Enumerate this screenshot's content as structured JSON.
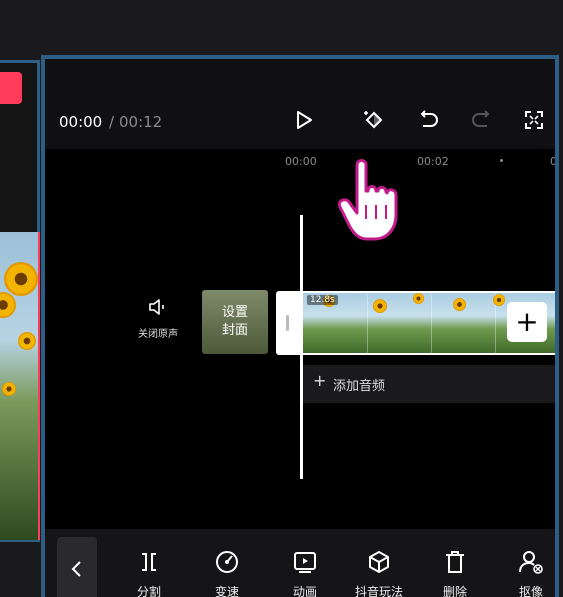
{
  "left_panel": {
    "badge_text": ""
  },
  "player": {
    "current_time": "00:00",
    "separator": "/",
    "total_time": "00:12"
  },
  "toolbar": {
    "icons": [
      "play-icon",
      "keyframe-icon",
      "undo-icon",
      "redo-icon",
      "fullscreen-icon"
    ]
  },
  "ruler": {
    "ticks": [
      "00:00",
      "00:02",
      "0"
    ]
  },
  "track": {
    "mute_label": "关闭原声",
    "cover_label": "设置封面",
    "clip_duration": "12.8s",
    "add_clip": "+"
  },
  "audio": {
    "plus": "+",
    "label": "添加音频"
  },
  "bottom_tools": [
    {
      "label": "分割",
      "icon": "split-icon"
    },
    {
      "label": "变速",
      "icon": "speed-icon"
    },
    {
      "label": "动画",
      "icon": "animation-icon"
    },
    {
      "label": "抖音玩法",
      "icon": "effects-cube-icon"
    },
    {
      "label": "删除",
      "icon": "delete-icon"
    },
    {
      "label": "抠像",
      "icon": "cutout-icon"
    }
  ],
  "colors": {
    "accent_red": "#ff3d5a",
    "frame_blue": "#2e5e86"
  }
}
